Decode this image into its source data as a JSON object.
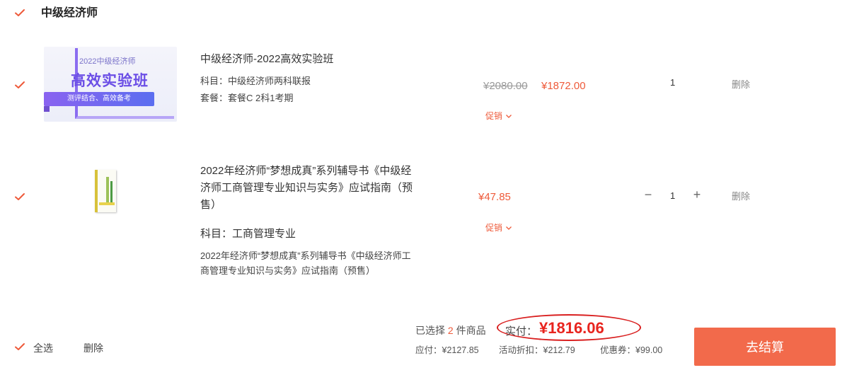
{
  "colors": {
    "accent": "#ee5a3a",
    "check": "#ee5a3a",
    "checkout_bg": "#f26a4b",
    "pay_red": "#e8241e",
    "highlight_ellipse": "#d92020"
  },
  "group": {
    "title": "中级经济师"
  },
  "items": [
    {
      "thumb": {
        "small_text": "2022中级经济师",
        "big_text": "高效实验班",
        "band_text": "测评结合、高效备考"
      },
      "title": "中级经济师-2022高效实验班",
      "meta": [
        "科目：中级经济师两科联报",
        "套餐：套餐C 2科1考期"
      ],
      "price_old": "¥2080.00",
      "price_now": "¥1872.00",
      "promo": "促销",
      "qty": "1",
      "delete": "删除"
    },
    {
      "title_lines": [
        "2022年经济师“梦想成真”系列辅导书《中级经",
        "济师工商管理专业知识与实务》应试指南（预",
        "售）"
      ],
      "subject": "科目：工商管理专业",
      "desc_lines": [
        "2022年经济师“梦想成真”系列辅导书《中级经济师工",
        "商管理专业知识与实务》应试指南（预售）"
      ],
      "price_now": "¥47.85",
      "promo": "促销",
      "qty_minus": "−",
      "qty": "1",
      "qty_plus": "+",
      "delete": "删除"
    }
  ],
  "footer": {
    "select_all": "全选",
    "delete": "删除",
    "selected_prefix": "已选择",
    "selected_count": "2",
    "selected_suffix": "件商品",
    "pay_label": "实付：",
    "pay_amount": "¥1816.06",
    "due": "应付：¥2127.85",
    "discount": "活动折扣：¥212.79",
    "coupon": "优惠券：¥99.00",
    "checkout": "去结算"
  }
}
